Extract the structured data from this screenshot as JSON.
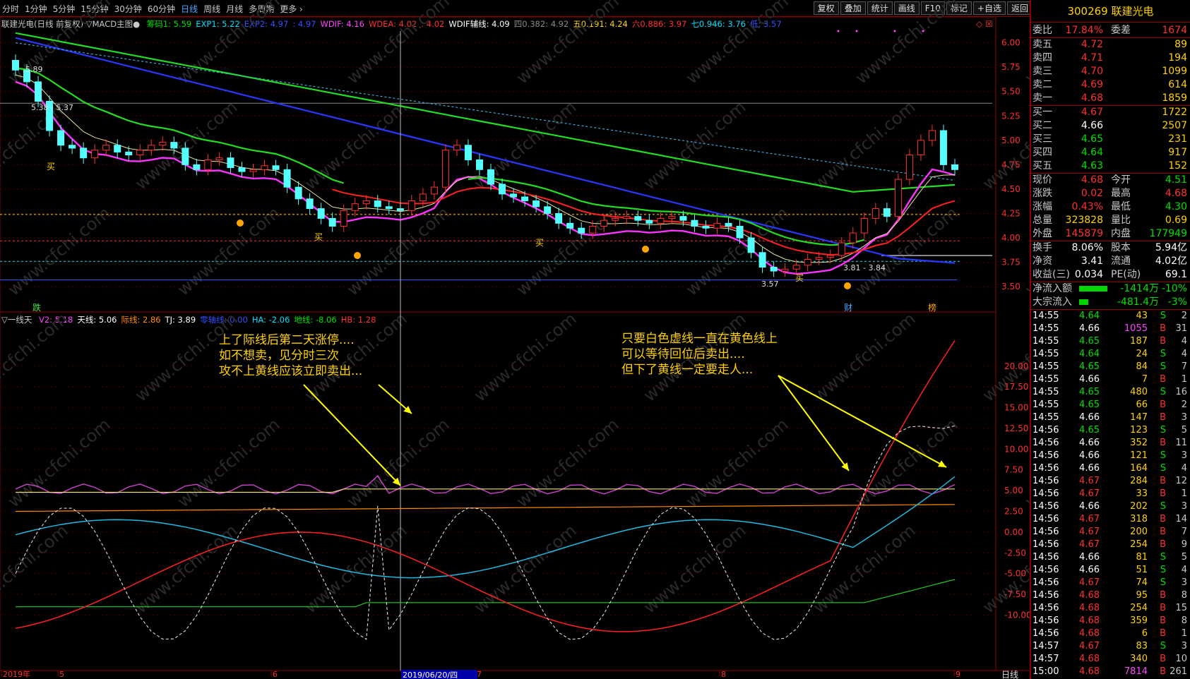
{
  "toolbar": {
    "periods": [
      "分时",
      "1分钟",
      "5分钟",
      "15分钟",
      "30分钟",
      "60分钟",
      "日线",
      "周线",
      "月线",
      "多周期",
      "更多"
    ],
    "active_period": "日线",
    "tools": [
      "复权",
      "叠加",
      "统计",
      "画线",
      "F10",
      "标记",
      "+自选",
      "返回"
    ]
  },
  "main_legend": {
    "title": "联建光电(日线 前复权) ▽MACD主图●",
    "items": [
      {
        "text": "筹码1: 5.59",
        "color": "#00e000"
      },
      {
        "text": "EXP1: 5.22",
        "color": "#00e0ff"
      },
      {
        "text": "EXP2: 4.97",
        "color": "#3050ff"
      },
      {
        "text": ": 4.97",
        "color": "#3050ff"
      },
      {
        "text": "WDIF: 4.16",
        "color": "#ff44ff"
      },
      {
        "text": "WDEA: 4.02",
        "color": "#ff3030"
      },
      {
        "text": ": 4.02",
        "color": "#ff3030"
      },
      {
        "text": "WDIF辅线: 4.09",
        "color": "#ffffff"
      },
      {
        "text": "四0.382: 4.92",
        "color": "#888888"
      },
      {
        "text": "五0.191: 4.24",
        "color": "#ffd100"
      },
      {
        "text": "六0.886: 3.97",
        "color": "#ff3030"
      },
      {
        "text": "七0.946: 3.76",
        "color": "#00e0ff"
      },
      {
        "text": "低: 3.57",
        "color": "#3050ff"
      }
    ]
  },
  "main_price_axis": [
    "6.00",
    "5.75",
    "5.50",
    "5.25",
    "5.00",
    "4.75",
    "4.50",
    "4.25",
    "4.00",
    "3.75",
    "3.50"
  ],
  "main_annotations": {
    "high_label": "5.89",
    "mid_label": "5.38 - 5.37",
    "low_label": "3.57",
    "low2_label": "3.81 - 3.84",
    "buy1": "买",
    "buy2": "买",
    "buy3": "买",
    "buy4": "买",
    "event_fall": "跌",
    "event_fin": "财",
    "event_rank": "榜"
  },
  "sub_legend": {
    "title": "▽一线天",
    "items": [
      {
        "text": "V2: 5.18",
        "color": "#ff44ff"
      },
      {
        "text": "天线: 5.06",
        "color": "#ffffff"
      },
      {
        "text": "际线: 2.86",
        "color": "#ff8c00"
      },
      {
        "text": "TJ: 3.89",
        "color": "#ffffff"
      },
      {
        "text": "零轴线: 0.00",
        "color": "#3050ff"
      },
      {
        "text": "HA: -2.06",
        "color": "#00e0ff"
      },
      {
        "text": "地线: -8.06",
        "color": "#00e000"
      },
      {
        "text": "HB: 1.28",
        "color": "#ff3030"
      }
    ]
  },
  "sub_axis": [
    "20.00",
    "17.50",
    "15.00",
    "12.50",
    "10.00",
    "7.50",
    "5.00",
    "2.50",
    "0.00",
    "-2.50",
    "-5.00",
    "-7.50",
    "-10.00"
  ],
  "notes": {
    "left": [
      "上了际线后第二天涨停....",
      "如不想卖，见分时三次",
      "攻不上黄线应该立即卖出..."
    ],
    "right": [
      "只要白色虚线一直在黄色线上",
      "可以等待回位后卖出....",
      "但下了黄线一定要走人..."
    ]
  },
  "date_axis": {
    "labels": [
      "2019年",
      "5",
      "6",
      "7",
      "8",
      "9"
    ],
    "cursor_date": "2019/06/20/四",
    "period_label": "日线"
  },
  "watermark": "www.cfchi.com",
  "panel": {
    "code": "300269",
    "name": "联建光电",
    "weibi_label": "委比",
    "weibi": "17.84%",
    "weicha_label": "委差",
    "weicha": "1674",
    "asks": [
      {
        "label": "卖五",
        "price": "4.72",
        "vol": "89"
      },
      {
        "label": "卖四",
        "price": "4.71",
        "vol": "194"
      },
      {
        "label": "卖三",
        "price": "4.70",
        "vol": "1099"
      },
      {
        "label": "卖二",
        "price": "4.69",
        "vol": "614"
      },
      {
        "label": "卖一",
        "price": "4.68",
        "vol": "1859"
      }
    ],
    "bids": [
      {
        "label": "买一",
        "price": "4.67",
        "vol": "1722"
      },
      {
        "label": "买二",
        "price": "4.66",
        "vol": "2507"
      },
      {
        "label": "买三",
        "price": "4.65",
        "vol": "231"
      },
      {
        "label": "买四",
        "price": "4.64",
        "vol": "917"
      },
      {
        "label": "买五",
        "price": "4.63",
        "vol": "152"
      }
    ],
    "quote": [
      {
        "l1": "现价",
        "v1": "4.68",
        "c1": "r",
        "l2": "今开",
        "v2": "4.51",
        "c2": "g"
      },
      {
        "l1": "涨跌",
        "v1": "0.02",
        "c1": "r",
        "l2": "最高",
        "v2": "4.68",
        "c2": "r"
      },
      {
        "l1": "涨幅",
        "v1": "0.43%",
        "c1": "r",
        "l2": "最低",
        "v2": "4.30",
        "c2": "g"
      },
      {
        "l1": "总量",
        "v1": "323828",
        "c1": "y",
        "l2": "量比",
        "v2": "0.69",
        "c2": "y"
      },
      {
        "l1": "外盘",
        "v1": "145879",
        "c1": "r",
        "l2": "内盘",
        "v2": "177949",
        "c2": "g"
      }
    ],
    "stats": [
      {
        "l1": "换手",
        "v1": "8.06%",
        "l2": "股本",
        "v2": "5.94亿"
      },
      {
        "l1": "净资",
        "v1": "3.41",
        "l2": "流通",
        "v2": "4.02亿"
      },
      {
        "l1": "收益(三)",
        "v1": "0.034",
        "l2": "PE(动)",
        "v2": "69.1"
      }
    ],
    "flows": [
      {
        "label": "净流入额",
        "value": "-1414万",
        "pct": "-10%",
        "bar": 0.8
      },
      {
        "label": "大宗流入",
        "value": "-481.4万",
        "pct": "-3%",
        "bar": 0.25
      }
    ],
    "ticks": [
      {
        "t": "14:55",
        "p": "4.64",
        "pc": "g",
        "v": "43",
        "vc": "y",
        "d": "S",
        "n": "2"
      },
      {
        "t": "14:55",
        "p": "4.66",
        "pc": "w",
        "v": "1055",
        "vc": "m",
        "d": "B",
        "n": "31"
      },
      {
        "t": "14:55",
        "p": "4.65",
        "pc": "g",
        "v": "187",
        "vc": "y",
        "d": "B",
        "n": "4"
      },
      {
        "t": "14:55",
        "p": "4.64",
        "pc": "g",
        "v": "24",
        "vc": "y",
        "d": "S",
        "n": "4"
      },
      {
        "t": "14:55",
        "p": "4.65",
        "pc": "g",
        "v": "84",
        "vc": "y",
        "d": "S",
        "n": "7"
      },
      {
        "t": "14:55",
        "p": "4.66",
        "pc": "w",
        "v": "7",
        "vc": "y",
        "d": "B",
        "n": "1"
      },
      {
        "t": "14:55",
        "p": "4.65",
        "pc": "g",
        "v": "480",
        "vc": "y",
        "d": "S",
        "n": "16"
      },
      {
        "t": "14:55",
        "p": "4.65",
        "pc": "g",
        "v": "66",
        "vc": "y",
        "d": "B",
        "n": "2"
      },
      {
        "t": "14:55",
        "p": "4.66",
        "pc": "w",
        "v": "147",
        "vc": "y",
        "d": "B",
        "n": "3"
      },
      {
        "t": "14:56",
        "p": "4.65",
        "pc": "g",
        "v": "123",
        "vc": "y",
        "d": "S",
        "n": "5"
      },
      {
        "t": "14:56",
        "p": "4.66",
        "pc": "w",
        "v": "352",
        "vc": "y",
        "d": "B",
        "n": "11"
      },
      {
        "t": "14:56",
        "p": "4.66",
        "pc": "w",
        "v": "121",
        "vc": "y",
        "d": "S",
        "n": "3"
      },
      {
        "t": "14:56",
        "p": "4.66",
        "pc": "w",
        "v": "164",
        "vc": "y",
        "d": "S",
        "n": "4"
      },
      {
        "t": "14:56",
        "p": "4.67",
        "pc": "r",
        "v": "284",
        "vc": "y",
        "d": "B",
        "n": "12"
      },
      {
        "t": "14:56",
        "p": "4.67",
        "pc": "r",
        "v": "33",
        "vc": "y",
        "d": "B",
        "n": "1"
      },
      {
        "t": "14:56",
        "p": "4.66",
        "pc": "w",
        "v": "202",
        "vc": "y",
        "d": "S",
        "n": "3"
      },
      {
        "t": "14:56",
        "p": "4.67",
        "pc": "r",
        "v": "318",
        "vc": "y",
        "d": "B",
        "n": "14"
      },
      {
        "t": "14:56",
        "p": "4.67",
        "pc": "r",
        "v": "200",
        "vc": "y",
        "d": "B",
        "n": "7"
      },
      {
        "t": "14:56",
        "p": "4.67",
        "pc": "r",
        "v": "254",
        "vc": "y",
        "d": "B",
        "n": "9"
      },
      {
        "t": "14:56",
        "p": "4.66",
        "pc": "w",
        "v": "81",
        "vc": "y",
        "d": "S",
        "n": "5"
      },
      {
        "t": "14:56",
        "p": "4.66",
        "pc": "w",
        "v": "51",
        "vc": "y",
        "d": "S",
        "n": "4"
      },
      {
        "t": "14:56",
        "p": "4.67",
        "pc": "r",
        "v": "74",
        "vc": "y",
        "d": "S",
        "n": "3"
      },
      {
        "t": "14:56",
        "p": "4.68",
        "pc": "r",
        "v": "95",
        "vc": "y",
        "d": "B",
        "n": "8"
      },
      {
        "t": "14:56",
        "p": "4.68",
        "pc": "r",
        "v": "254",
        "vc": "y",
        "d": "B",
        "n": "15"
      },
      {
        "t": "14:56",
        "p": "4.68",
        "pc": "r",
        "v": "359",
        "vc": "y",
        "d": "B",
        "n": "8"
      },
      {
        "t": "14:56",
        "p": "4.68",
        "pc": "r",
        "v": "6",
        "vc": "y",
        "d": "B",
        "n": "1"
      },
      {
        "t": "14:57",
        "p": "4.67",
        "pc": "r",
        "v": "83",
        "vc": "y",
        "d": "S",
        "n": "3"
      },
      {
        "t": "14:57",
        "p": "4.68",
        "pc": "r",
        "v": "340",
        "vc": "y",
        "d": "B",
        "n": "10"
      },
      {
        "t": "15:00",
        "p": "4.68",
        "pc": "r",
        "v": "7814",
        "vc": "m",
        "d": "B",
        "n": "261"
      }
    ]
  },
  "chart_data": {
    "type": "line",
    "candles_close": [
      5.72,
      5.6,
      5.4,
      5.1,
      4.95,
      4.92,
      4.82,
      4.9,
      4.95,
      4.88,
      4.85,
      4.9,
      4.95,
      4.98,
      4.92,
      4.75,
      4.7,
      4.8,
      4.82,
      4.72,
      4.68,
      4.7,
      4.74,
      4.7,
      4.52,
      4.4,
      4.3,
      4.2,
      4.12,
      4.28,
      4.35,
      4.38,
      4.32,
      4.3,
      4.28,
      4.38,
      4.45,
      4.52,
      4.9,
      4.95,
      4.8,
      4.7,
      4.55,
      4.45,
      4.42,
      4.38,
      4.32,
      4.25,
      4.15,
      4.1,
      4.05,
      4.12,
      4.18,
      4.2,
      4.22,
      4.18,
      4.15,
      4.2,
      4.22,
      4.18,
      4.12,
      4.1,
      4.15,
      4.12,
      4.0,
      3.85,
      3.7,
      3.66,
      3.68,
      3.72,
      3.78,
      3.8,
      3.82,
      3.95,
      4.05,
      4.2,
      4.3,
      4.22,
      4.6,
      4.85,
      5.0,
      5.1,
      4.75,
      4.7
    ],
    "zero_axis": 0.0
  }
}
